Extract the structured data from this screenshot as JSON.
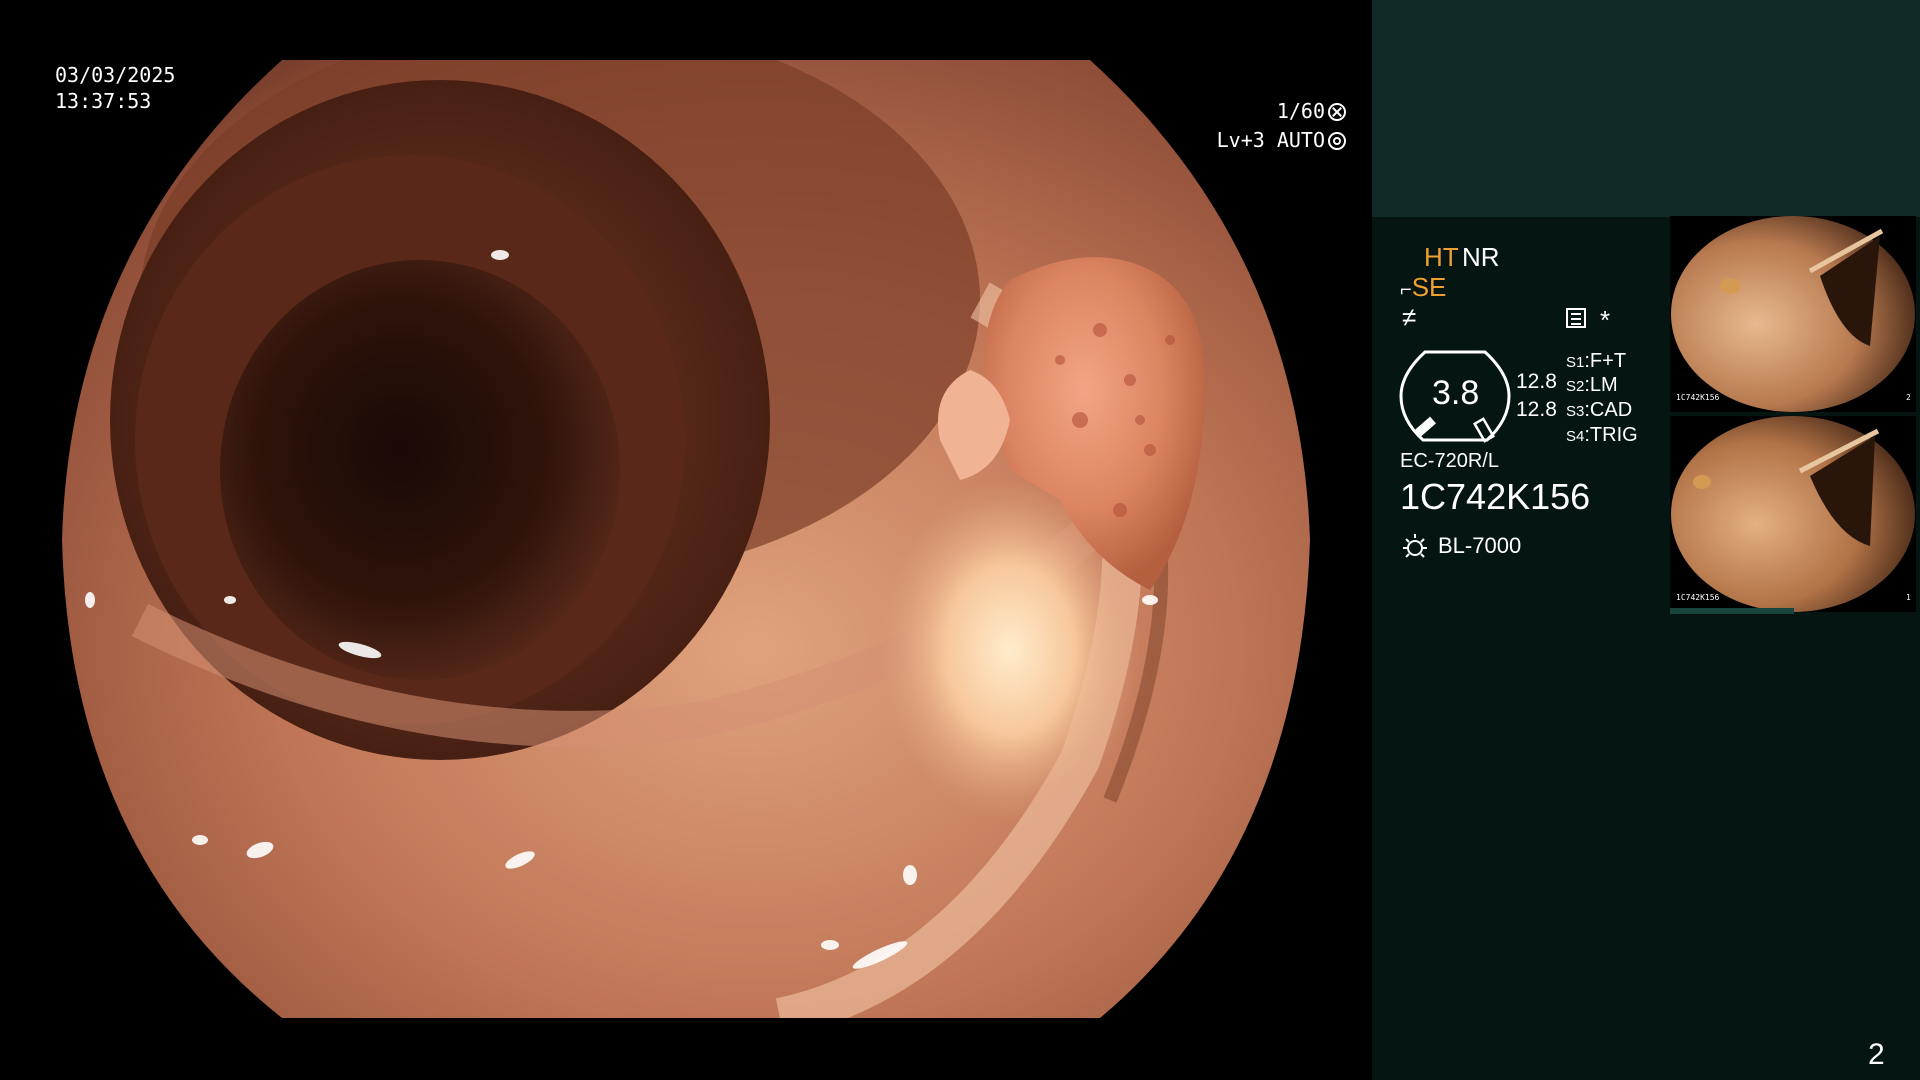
{
  "overlay": {
    "date": "03/03/2025",
    "time": "13:37:53",
    "shutter": "1/60",
    "gain": "Lv+3 AUTO",
    "shutter_icon": "aperture-icon",
    "gain_icon": "iris-icon"
  },
  "panel": {
    "ht": "HT",
    "nr": "NR",
    "se": "SE",
    "f_icon": "f-icon",
    "menu_icon": "menu-icon",
    "asterisk": "*",
    "gauge_value": "3.8",
    "value_1": "12.8",
    "value_2": "12.8",
    "switches": [
      {
        "key": "S1",
        "value": "F+T"
      },
      {
        "key": "S2",
        "value": "LM"
      },
      {
        "key": "S3",
        "value": "CAD"
      },
      {
        "key": "S4",
        "value": "TRIG"
      }
    ],
    "model": "EC-720R/L",
    "serial": "1C742K156",
    "light_source": "BL-7000",
    "page_number": "2"
  },
  "thumbnails": [
    {
      "label": "1C742K156",
      "index": "2"
    },
    {
      "label": "1C742K156",
      "index": "1"
    }
  ],
  "colors": {
    "panel_bg": "#051512",
    "panel_top": "#0f2a26",
    "accent_orange": "#f0a030"
  }
}
